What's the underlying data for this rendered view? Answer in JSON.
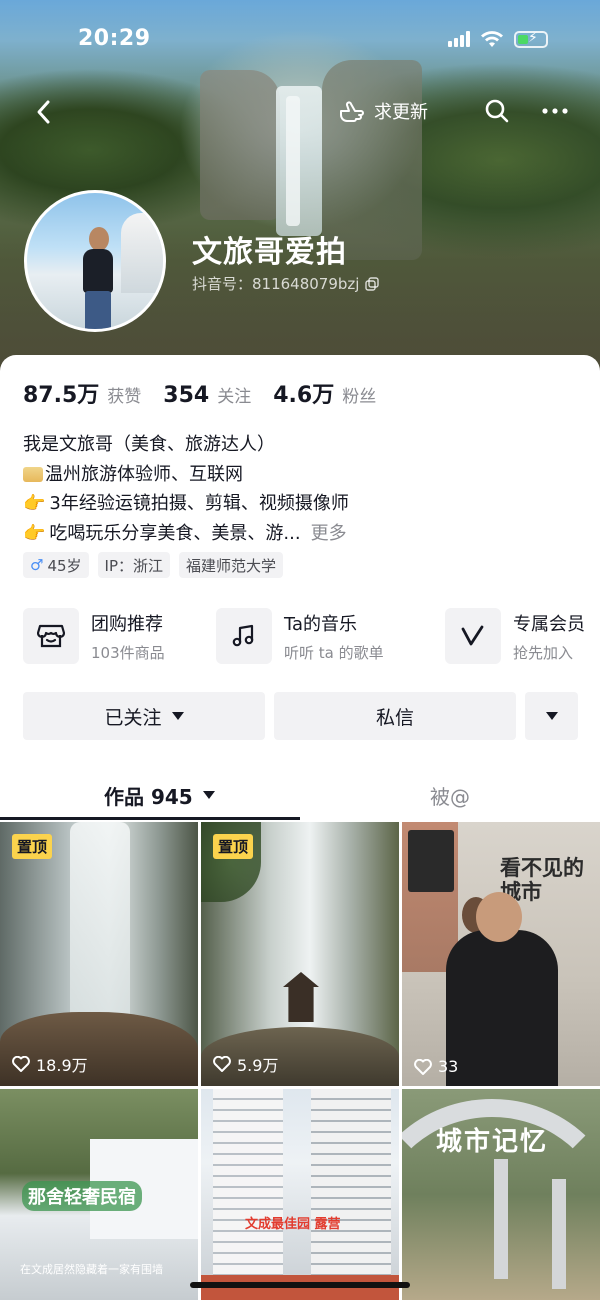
{
  "status": {
    "time": "20:29"
  },
  "nav": {
    "update_label": "求更新"
  },
  "profile": {
    "nickname": "文旅哥爱拍",
    "douyin_id": "抖音号：811648079bzj"
  },
  "stats": [
    {
      "value": "87.5万",
      "label": "获赞"
    },
    {
      "value": "354",
      "label": "关注"
    },
    {
      "value": "4.6万",
      "label": "粉丝"
    }
  ],
  "bio": {
    "line1": "我是文旅哥（美食、旅游达人）",
    "line2": "温州旅游体验师、互联网",
    "line3": "3年经验运镜拍摄、剪辑、视频摄像师",
    "line4": "吃喝玩乐分享美食、美景、游...",
    "more": "更多"
  },
  "tags": {
    "age": "45岁",
    "ip": "IP：浙江",
    "school": "福建师范大学"
  },
  "services": [
    {
      "title": "团购推荐",
      "sub": "103件商品",
      "icon": "shop-icon"
    },
    {
      "title": "Ta的音乐",
      "sub": "听听 ta 的歌单",
      "icon": "music-note-icon"
    },
    {
      "title": "专属会员",
      "sub": "抢先加入",
      "icon": "v-member-icon"
    }
  ],
  "actions": {
    "follow": "已关注",
    "message": "私信"
  },
  "tabs": {
    "works": "作品 945",
    "mentioned": "被@"
  },
  "videos": [
    {
      "pinned": "置顶",
      "likes": "18.9万"
    },
    {
      "pinned": "置顶",
      "likes": "5.9万"
    },
    {
      "likes": "33",
      "overlay": "看不见的城市"
    },
    {
      "overlay": "那舍轻奢民宿",
      "caption": "在文成居然隐藏着一家有围墙"
    },
    {
      "overlay": "文成最佳园 露营"
    },
    {
      "overlay": "城市记忆"
    }
  ],
  "colors": {
    "pin_bg": "#fbd34d",
    "male": "#4a8ff5",
    "muted": "#8a8b91"
  }
}
